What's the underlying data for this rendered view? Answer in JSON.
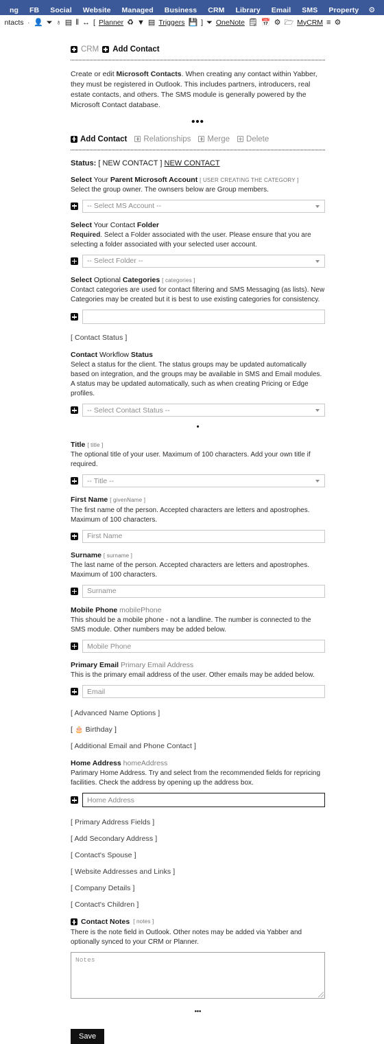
{
  "topnav": {
    "items": [
      "ng",
      "FB",
      "Social",
      "Website",
      "Managed",
      "Business",
      "CRM",
      "Library",
      "Email",
      "SMS",
      "Property"
    ],
    "gear": "⚙",
    "bg_color": "#3b5998"
  },
  "toolbar": {
    "label": "ntacts",
    "separator": "·",
    "add_person_icon": "👤",
    "note_icon": "⏷",
    "mic_icon": "♁",
    "calendar_icon": "▤",
    "sliders_icon": "⦀",
    "arrows_icon": "↔",
    "bracket_open": "[",
    "planner_label": "Planner",
    "recycle_icon": "♻",
    "filter_icon": "▼",
    "list_icon": "▤",
    "triggers_label": "Triggers",
    "save_icon": "💾",
    "bracket_close": "]",
    "onenote_note_icon": "⏷",
    "onenote_label": "OneNote",
    "clipboard_icon": "🗒",
    "calendar2_icon": "📅",
    "group_icon": "⚙",
    "folder_icon": "🗁",
    "mycrm_label": "MyCRM",
    "hamburger_icon": "≡",
    "gear_icon": "⚙"
  },
  "breadcrumb": {
    "parent": "CRM",
    "current": "Add Contact"
  },
  "intro": {
    "part1": "Create or edit ",
    "bold1": "Microsoft Contacts",
    "part2": ". When creating any contact within Yabber, they must be registered in Outlook. This includes partners, introducers, real estate contacts, and others. The SMS module is generally powered by the Microsoft Contact database.",
    "ellipsis": "•••"
  },
  "tabs": [
    {
      "label": "Add Contact",
      "active": true
    },
    {
      "label": "Relationships",
      "active": false
    },
    {
      "label": "Merge",
      "active": false
    },
    {
      "label": "Delete",
      "active": false
    }
  ],
  "status": {
    "label": "Status:",
    "bracketed": "[ NEW CONTACT ]",
    "link": "NEW CONTACT"
  },
  "fields": [
    {
      "id": "ms-account",
      "label_b1": "Select",
      "label_n1": " Your ",
      "label_b2": "Parent Microsoft Account",
      "label_tiny": "[ USER CREATING THE CATEGORY ]",
      "desc": "Select the group owner. The ownsers below are Group members.",
      "control": "select",
      "value": "-- Select MS Account --"
    },
    {
      "id": "contact-folder",
      "label_b1": "Select",
      "label_n1": " Your Contact ",
      "label_b2": "Folder",
      "label_tiny": "",
      "desc_b": "Required",
      "desc": ". Select a Folder associated with the user. Please ensure that you are selecting a folder associated with your selected user account.",
      "control": "select",
      "value": "-- Select Folder --"
    },
    {
      "id": "categories",
      "label_b1": "Select",
      "label_n1": " Optional ",
      "label_b2": "Categories",
      "label_tiny": "[ categories ]",
      "desc": "Contact categories are used for contact filtering and SMS Messaging (as lists). New Categories may be created but it is best to use existing categories for consistency.",
      "control": "input",
      "value": ""
    }
  ],
  "contact_status_link": "[ Contact Status ]",
  "workflow": {
    "label_b1": "Contact",
    "label_n1": " Workflow ",
    "label_b2": "Status",
    "desc": "Select a status for the client. The status groups may be updated automatically based on integration, and the groups may be available in SMS and Email modules. A status may be updated automatically, such as when creating Pricing or Edge profiles.",
    "value": "-- Select Contact Status --"
  },
  "mid_dot": "•",
  "fields2": [
    {
      "id": "title",
      "label_b1": "Title",
      "label_tiny": "[ title ]",
      "desc": "The optional title of your user. Maximum of 100 characters. Add your own title if required.",
      "control": "select",
      "value": "-- Title --"
    },
    {
      "id": "first-name",
      "label_b1": "First Name",
      "label_tiny": "[ givenName ]",
      "desc": "The first name of the person. Accepted characters are letters and apostrophes. Maximum of 100 characters.",
      "control": "input",
      "value": "First Name"
    },
    {
      "id": "surname",
      "label_b1": "Surname",
      "label_tiny": "[ surname ]",
      "desc": "The last name of the person. Accepted characters are letters and apostrophes. Maximum of 100 characters.",
      "control": "input",
      "value": "Surname"
    },
    {
      "id": "mobile-phone",
      "label_b1": "Mobile Phone",
      "label_gray": "mobilePhone",
      "desc": "This should be a mobile phone - not a landline. The number is connected to the SMS module. Other numbers may be added below.",
      "control": "input",
      "value": "Mobile Phone"
    },
    {
      "id": "primary-email",
      "label_b1": "Primary Email",
      "label_gray": "Primary Email Address",
      "desc": "This is the primary email address of the user. Other emails may be added below.",
      "control": "input",
      "value": "Email"
    }
  ],
  "links_mid": [
    {
      "id": "advanced-name-options",
      "text": "[ Advanced Name Options ]",
      "icon": ""
    },
    {
      "id": "birthday",
      "text": "Birthday",
      "icon": "🎂",
      "bracketed": true
    },
    {
      "id": "additional-email-phone",
      "text": "[ Additional Email and Phone Contact ]",
      "icon": ""
    }
  ],
  "home_address": {
    "label_b1": "Home Address",
    "label_gray": "homeAddress",
    "desc": "Parimary Home Address. Try and select from the recommended fields for repricing facilities. Check the address by opening up the address box.",
    "value": "Home Address"
  },
  "links_bottom": [
    "[ Primary Address Fields ]",
    "[ Add Secondary Address ]",
    "[ Contact's Spouse ]",
    "[ Website Addresses and Links ]",
    "[ Company Details ]",
    "[ Contact's Children ]"
  ],
  "notes": {
    "label": "Contact Notes",
    "label_tiny": "[ notes ]",
    "desc": "There is the note field in Outlook. Other notes may be added via Yabber and optionally synced to your CRM or Planner.",
    "placeholder": "Notes"
  },
  "footer": {
    "ellipsis": "•••",
    "save_label": "Save"
  }
}
